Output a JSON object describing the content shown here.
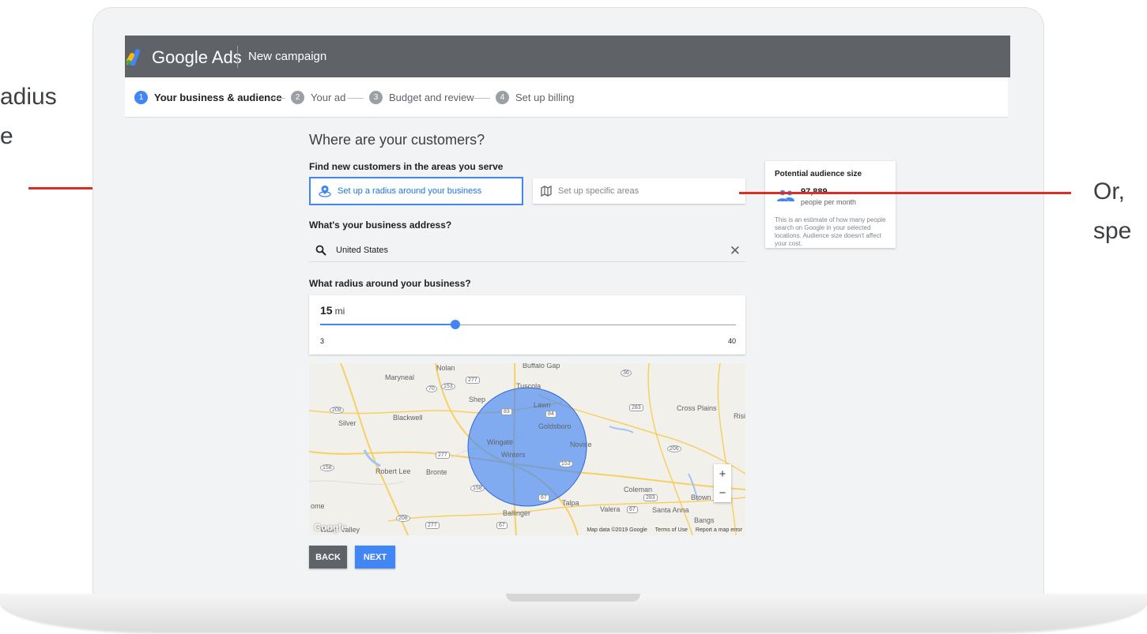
{
  "left_callout": {
    "line1": "adius",
    "line2": "e"
  },
  "right_callout": {
    "line1": "Or,",
    "line2": "spe"
  },
  "app": {
    "brand": "Google Ads",
    "subtitle": "New campaign"
  },
  "steps": [
    {
      "number": "1",
      "label": "Your business & audience",
      "active": true
    },
    {
      "number": "2",
      "label": "Your ad",
      "active": false
    },
    {
      "number": "3",
      "label": "Budget and review",
      "active": false
    },
    {
      "number": "4",
      "label": "Set up billing",
      "active": false
    }
  ],
  "page": {
    "heading": "Where are your customers?",
    "areas_label": "Find new customers in the areas you serve",
    "option_radius": "Set up a radius around your business",
    "option_specific": "Set up specific areas",
    "address_label": "What's your business address?",
    "address_value": "United States",
    "radius_label": "What radius around your business?"
  },
  "radius": {
    "value": "15",
    "unit": "mi",
    "min": "3",
    "max": "40",
    "current": 15,
    "min_value": 3,
    "max_value": 40
  },
  "map": {
    "places": [
      "Nolan",
      "Buffalo Gap",
      "Maryneal",
      "Tuscola",
      "Shep",
      "Lawn",
      "Blackwell",
      "Silver",
      "Goldsboro",
      "Cross Plains",
      "Rising",
      "Wingate",
      "Novice",
      "Winters",
      "Robert Lee",
      "Bronte",
      "Coleman",
      "Talpa",
      "Valera",
      "Santa Anna",
      "Ballinger",
      "Bangs",
      "Brown",
      "ome",
      "Water Valley"
    ],
    "shields": [
      "277",
      "70",
      "153",
      "83",
      "84",
      "283",
      "36",
      "208",
      "277",
      "206",
      "158",
      "153",
      "158",
      "67",
      "283",
      "208",
      "277",
      "67",
      "67"
    ],
    "attribution": "Map data ©2019 Google",
    "terms": "Terms of Use",
    "report": "Report a map error",
    "logo": "Google",
    "zoom_in": "+",
    "zoom_out": "−"
  },
  "buttons": {
    "back": "BACK",
    "next": "NEXT"
  },
  "audience": {
    "title": "Potential audience size",
    "count": "97,889",
    "per": "people per month",
    "description": "This is an estimate of how many people search on Google in your selected locations. Audience size doesn't affect your cost."
  },
  "colors": {
    "accent": "#4285f4",
    "topbar": "#5f6368",
    "callout": "#d93025"
  }
}
